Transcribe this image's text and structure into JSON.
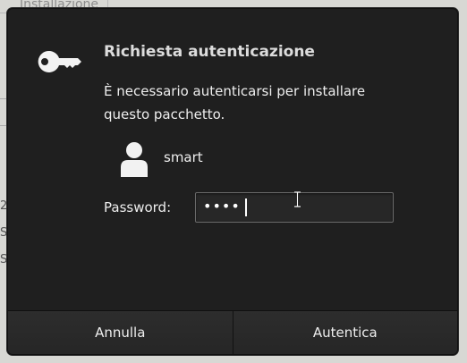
{
  "background": {
    "tab_label": "Installazione",
    "row_fragments": [
      "2",
      "S",
      "S"
    ]
  },
  "dialog": {
    "title": "Richiesta autenticazione",
    "message": "È necessario autenticarsi per installare questo pacchetto.",
    "icon": "key-icon",
    "user": {
      "icon": "user-avatar-icon",
      "name": "smart"
    },
    "password": {
      "label": "Password:",
      "value": "••••"
    },
    "buttons": {
      "cancel_label": "Annulla",
      "confirm_label": "Autentica"
    }
  },
  "colors": {
    "dialog_background": "#1f1f1f",
    "text": "#eeeeee",
    "title_text": "#dcdcdc"
  }
}
